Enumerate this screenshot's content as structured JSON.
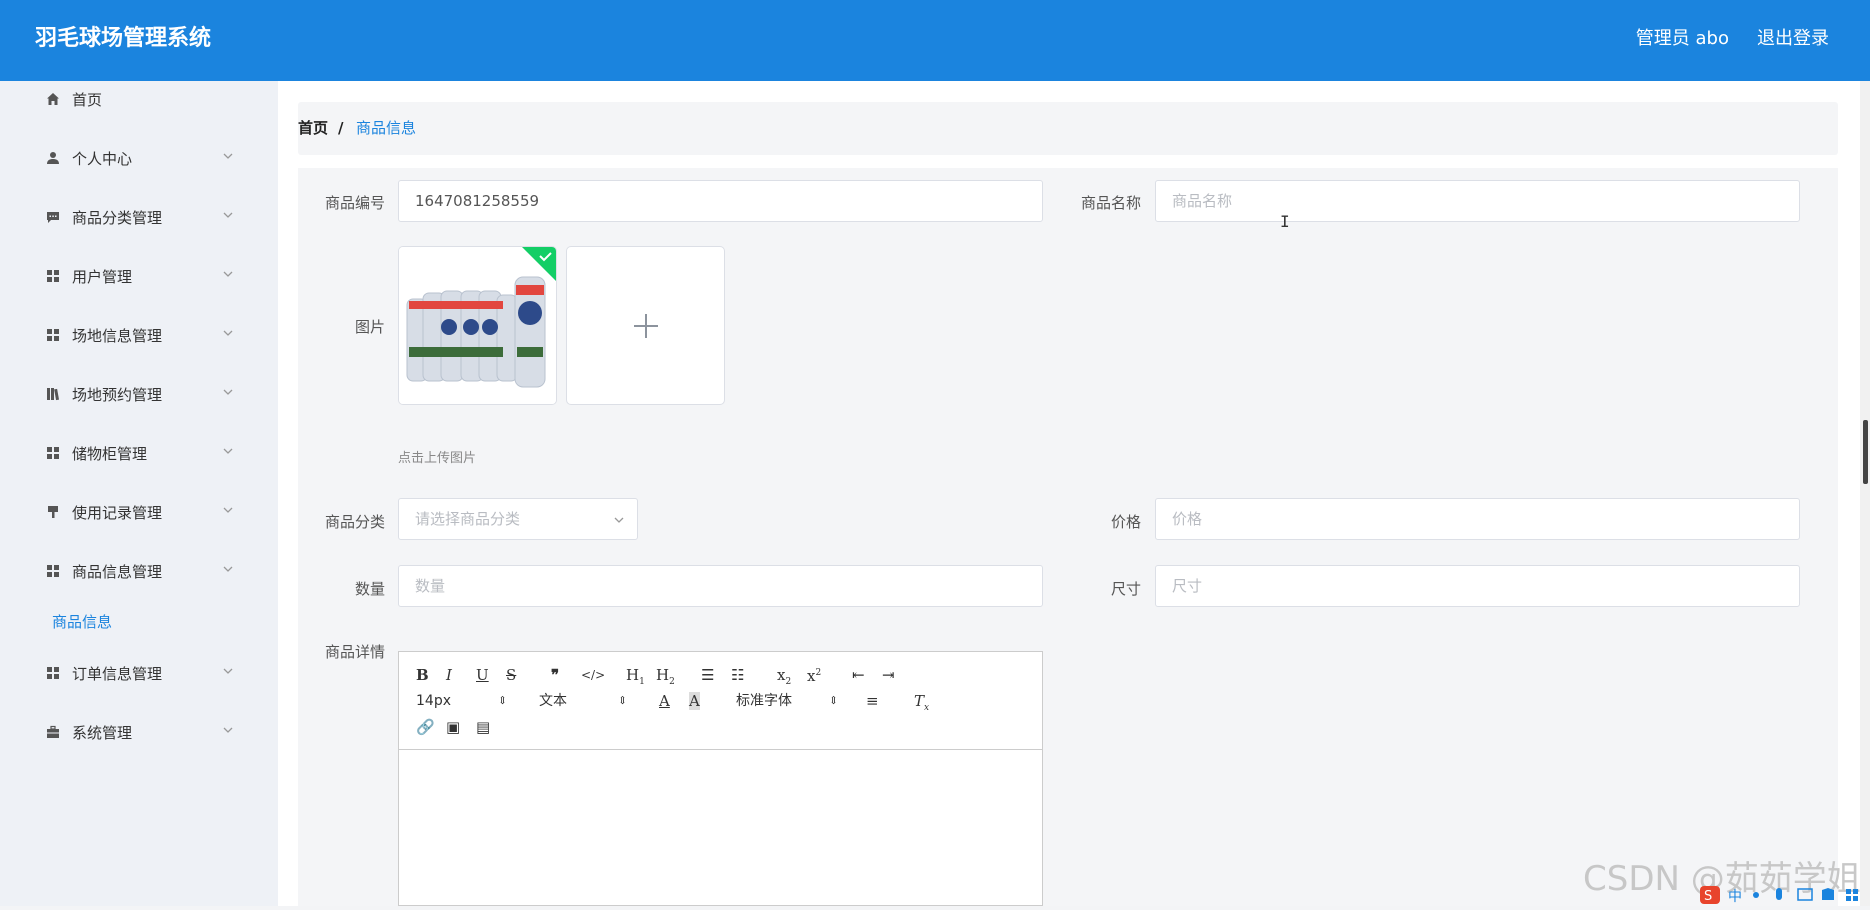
{
  "header": {
    "title": "羽毛球场管理系统",
    "user": "管理员 abo",
    "logout": "退出登录"
  },
  "sidebar": {
    "items": [
      {
        "label": "首页",
        "icon": "home-icon"
      },
      {
        "label": "个人中心",
        "icon": "user-icon"
      },
      {
        "label": "商品分类管理",
        "icon": "comment-icon"
      },
      {
        "label": "用户管理",
        "icon": "grid-icon"
      },
      {
        "label": "场地信息管理",
        "icon": "grid-icon"
      },
      {
        "label": "场地预约管理",
        "icon": "book-icon"
      },
      {
        "label": "储物柜管理",
        "icon": "grid-icon"
      },
      {
        "label": "使用记录管理",
        "icon": "brush-icon"
      },
      {
        "label": "商品信息管理",
        "icon": "grid-icon"
      },
      {
        "label": "商品信息",
        "sub": true
      },
      {
        "label": "订单信息管理",
        "icon": "grid-icon"
      },
      {
        "label": "系统管理",
        "icon": "briefcase-icon"
      }
    ]
  },
  "breadcrumb": {
    "home": "首页",
    "separator": "/",
    "current": "商品信息"
  },
  "form": {
    "code_label": "商品编号",
    "code_value": "1647081258559",
    "name_label": "商品名称",
    "name_placeholder": "商品名称",
    "image_label": "图片",
    "upload_hint": "点击上传图片",
    "category_label": "商品分类",
    "category_placeholder": "请选择商品分类",
    "price_label": "价格",
    "price_placeholder": "价格",
    "qty_label": "数量",
    "qty_placeholder": "数量",
    "size_label": "尺寸",
    "size_placeholder": "尺寸",
    "detail_label": "商品详情"
  },
  "editor": {
    "font_size": "14px",
    "text_type": "文本",
    "font_family": "标准字体"
  },
  "watermark": "CSDN @茹茹学姐",
  "colors": {
    "header": "#1b84de",
    "accent": "#1b84de",
    "sidebar_bg": "#eef1f6",
    "upload_success": "#13ce66"
  }
}
